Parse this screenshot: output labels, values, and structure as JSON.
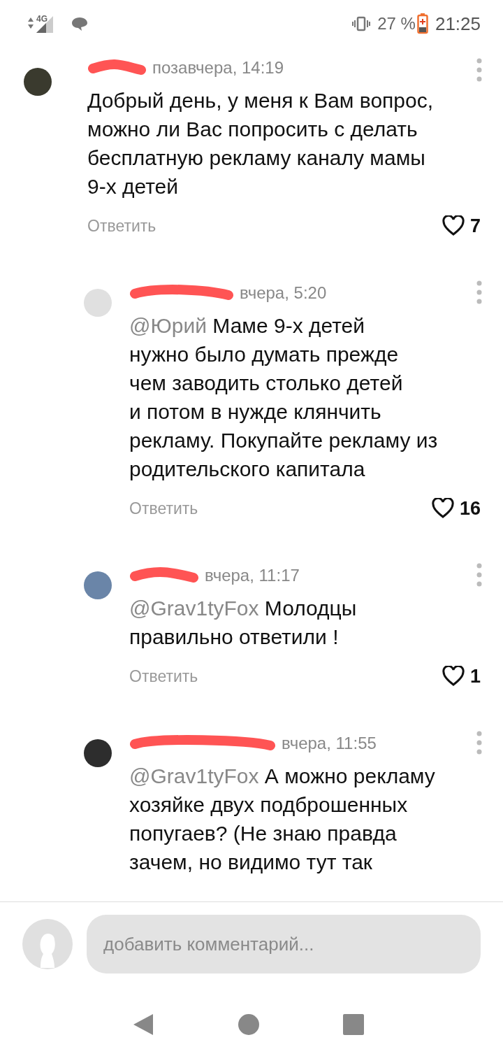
{
  "status_bar": {
    "network": "4G",
    "battery": "27 %",
    "time": "21:25"
  },
  "comments": [
    {
      "time": "позавчера, 14:19",
      "text": "Добрый день, у меня к Вам вопрос,\nможно ли Вас попросить с делать\nбесплатную рекламу каналу мамы\n9-х детей",
      "reply": "Ответить",
      "likes": "7",
      "children": [
        {
          "time": "вчера, 5:20",
          "mention": "@Юрий",
          "text": "Маме 9-х детей\nнужно было думать прежде\nчем заводить столько детей\nи потом в нужде клянчить\nрекламу. Покупайте рекламу из\nродительского капитала",
          "reply": "Ответить",
          "likes": "16"
        },
        {
          "time": "вчера, 11:17",
          "mention": "@Grav1tyFox",
          "text": "Молодцы\nправильно ответили !",
          "reply": "Ответить",
          "likes": "1"
        },
        {
          "time": "вчера, 11:55",
          "mention": "@Grav1tyFox",
          "text": "А можно рекламу\nхозяйке двух подброшенных\nпопугаев? (Не знаю правда\nзачем, но видимо тут так"
        }
      ]
    }
  ],
  "composer": {
    "placeholder": "добавить комментарий..."
  }
}
